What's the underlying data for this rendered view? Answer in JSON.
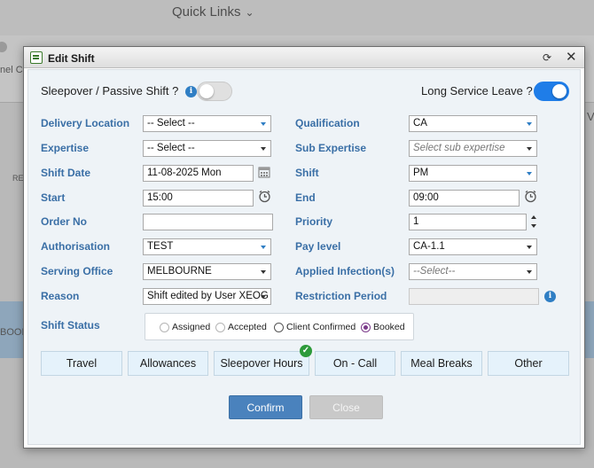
{
  "background": {
    "quick_links": "Quick Links",
    "frag_left": "nel C",
    "frag_re": "RE",
    "frag_book": "BOOK",
    "frag_v": "V"
  },
  "dialog": {
    "title": "Edit Shift"
  },
  "toggles": {
    "sleepover_label": "Sleepover / Passive Shift ?",
    "sleepover_on": false,
    "long_service_label": "Long Service Leave ?",
    "long_service_on": true
  },
  "form": {
    "delivery_location": {
      "label": "Delivery Location",
      "value": "-- Select --"
    },
    "expertise": {
      "label": "Expertise",
      "value": "-- Select --"
    },
    "shift_date": {
      "label": "Shift Date",
      "value": "11-08-2025 Mon"
    },
    "start": {
      "label": "Start",
      "value": "15:00"
    },
    "order_no": {
      "label": "Order No",
      "value": ""
    },
    "authorisation": {
      "label": "Authorisation",
      "value": "TEST"
    },
    "serving_office": {
      "label": "Serving Office",
      "value": "MELBOURNE"
    },
    "reason": {
      "label": "Reason",
      "value": "Shift edited by User XEOG"
    },
    "qualification": {
      "label": "Qualification",
      "value": "CA"
    },
    "sub_expertise": {
      "label": "Sub Expertise",
      "placeholder": "Select sub expertise"
    },
    "shift": {
      "label": "Shift",
      "value": "PM"
    },
    "end": {
      "label": "End",
      "value": "09:00"
    },
    "priority": {
      "label": "Priority",
      "value": "1"
    },
    "pay_level": {
      "label": "Pay level",
      "value": "CA-1.1"
    },
    "applied_infections": {
      "label": "Applied Infection(s)",
      "placeholder": "--Select--"
    },
    "restriction_period": {
      "label": "Restriction Period",
      "value": ""
    }
  },
  "shift_status": {
    "label": "Shift Status",
    "options": [
      "Assigned",
      "Accepted",
      "Client Confirmed",
      "Booked"
    ],
    "selected": "Booked"
  },
  "tabs": [
    "Travel",
    "Allowances",
    "Sleepover Hours",
    "On - Call",
    "Meal Breaks",
    "Other"
  ],
  "buttons": {
    "confirm": "Confirm",
    "close": "Close"
  },
  "colors": {
    "label_blue": "#3a6fa6",
    "confirm_blue": "#4a82bd",
    "toggle_on": "#1f7de8",
    "check_green": "#2d9a3a"
  }
}
